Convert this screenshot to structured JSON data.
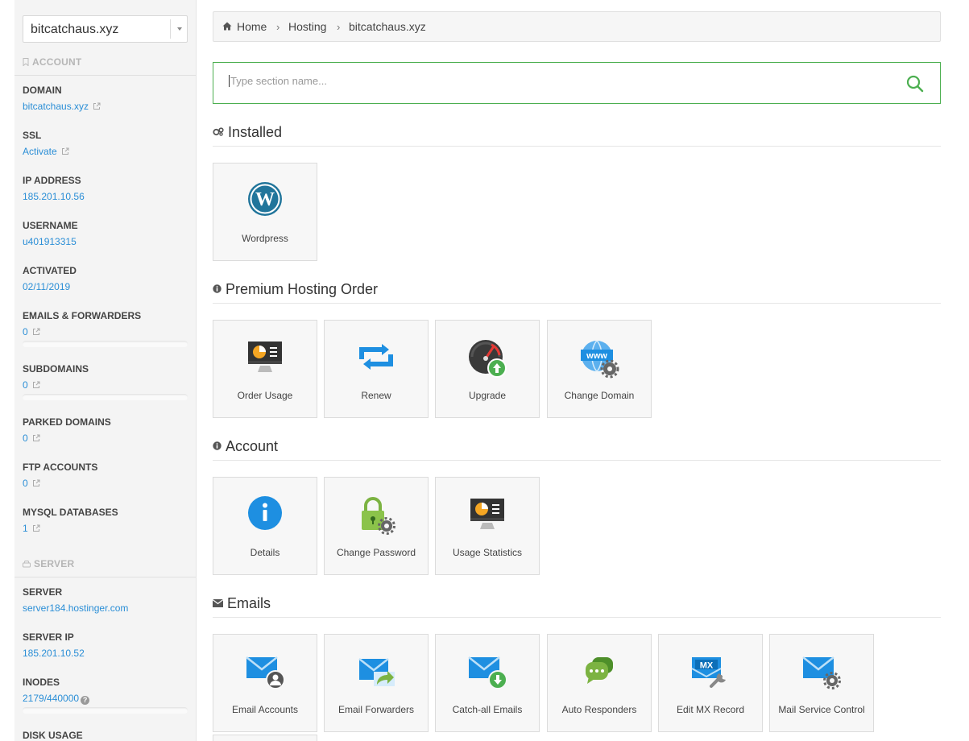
{
  "sidebar": {
    "domain_select": "bitcatchaus.xyz",
    "account_heading": "ACCOUNT",
    "server_heading": "SERVER",
    "items": [
      {
        "label": "DOMAIN",
        "value": "bitcatchaus.xyz"
      },
      {
        "label": "SSL",
        "value": "Activate"
      },
      {
        "label": "IP ADDRESS",
        "value": "185.201.10.56"
      },
      {
        "label": "USERNAME",
        "value": "u401913315"
      },
      {
        "label": "ACTIVATED",
        "value": "02/11/2019"
      },
      {
        "label": "EMAILS & FORWARDERS",
        "value": "0"
      },
      {
        "label": "SUBDOMAINS",
        "value": "0"
      },
      {
        "label": "PARKED DOMAINS",
        "value": "0"
      },
      {
        "label": "FTP ACCOUNTS",
        "value": "0"
      },
      {
        "label": "MYSQL DATABASES",
        "value": "1"
      }
    ],
    "server_items": [
      {
        "label": "SERVER",
        "value": "server184.hostinger.com"
      },
      {
        "label": "SERVER IP",
        "value": "185.201.10.52"
      },
      {
        "label": "INODES",
        "value": "2179/440000"
      },
      {
        "label": "DISK USAGE",
        "value": ""
      }
    ]
  },
  "breadcrumb": [
    "Home",
    "Hosting",
    "bitcatchaus.xyz"
  ],
  "search": {
    "placeholder": "Type section name..."
  },
  "sections": [
    {
      "title": "Installed",
      "tiles": [
        "Wordpress"
      ]
    },
    {
      "title": "Premium Hosting Order",
      "tiles": [
        "Order Usage",
        "Renew",
        "Upgrade",
        "Change Domain"
      ]
    },
    {
      "title": "Account",
      "tiles": [
        "Details",
        "Change Password",
        "Usage Statistics"
      ]
    },
    {
      "title": "Emails",
      "tiles": [
        "Email Accounts",
        "Email Forwarders",
        "Catch-all Emails",
        "Auto Responders",
        "Edit MX Record",
        "Mail Service Control"
      ]
    }
  ],
  "colors": {
    "link": "#2a8ed6",
    "accent_green": "#4caf50",
    "blue_icon": "#1e8fe1"
  }
}
